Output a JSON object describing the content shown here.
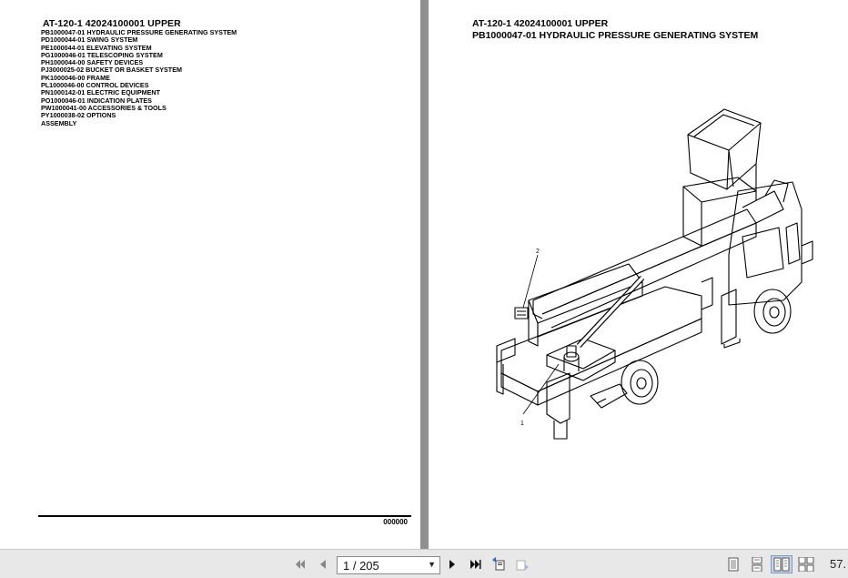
{
  "left_page": {
    "title": "AT-120-1 42024100001 UPPER",
    "toc": [
      "PB1000047-01 HYDRAULIC PRESSURE GENERATING SYSTEM",
      "PD1000044-01 SWING SYSTEM",
      "PE1000044-01 ELEVATING SYSTEM",
      "PG1000046-01 TELESCOPING SYSTEM",
      "PH1000044-00 SAFETY DEVICES",
      "PJ3000025-02 BUCKET OR BASKET SYSTEM",
      "PK1000046-00 FRAME",
      "PL1000046-00 CONTROL DEVICES",
      "PN1000142-01 ELECTRIC EQUIPMENT",
      "PO1000046-01 INDICATION PLATES",
      "PW1000041-00 ACCESSORIES & TOOLS",
      "PY1000038-02 OPTIONS",
      "ASSEMBLY"
    ],
    "footer_code": "000000"
  },
  "right_page": {
    "title_line1": "AT-120-1 42024100001 UPPER",
    "title_line2": "PB1000047-01 HYDRAULIC PRESSURE GENERATING SYSTEM",
    "callout_1": "1",
    "callout_2": "2"
  },
  "toolbar": {
    "page_indicator": "1 / 205",
    "zoom": "57.",
    "icons": {
      "first": "first-page-icon",
      "prev": "previous-page-icon",
      "next": "next-page-icon",
      "last": "last-page-icon",
      "back": "previous-view-icon",
      "forward": "next-view-icon",
      "single": "single-page-icon",
      "continuous": "continuous-icon",
      "facing": "facing-pages-icon",
      "continuous_facing": "continuous-facing-icon"
    }
  },
  "colors": {
    "toolbar_bg": "#e8e8e8",
    "viewer_bg": "#a0a0a0",
    "selected": "#c4d4e6"
  }
}
